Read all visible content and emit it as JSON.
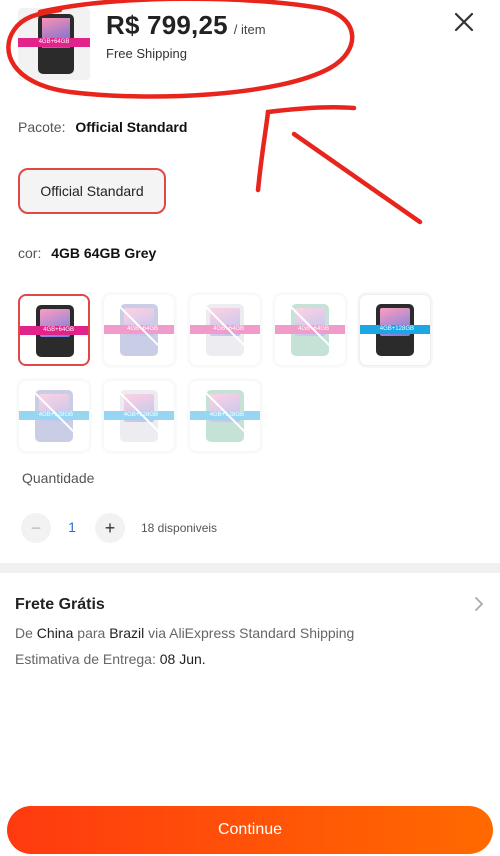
{
  "header": {
    "price": "R$ 799,25",
    "per_item": "/ item",
    "shipping_note": "Free Shipping",
    "thumb_badge": "4GB+64GB"
  },
  "package": {
    "label": "Pacote:",
    "selected": "Official Standard",
    "option": "Official Standard"
  },
  "color": {
    "label": "cor:",
    "selected": "4GB 64GB Grey"
  },
  "variants": [
    {
      "badge": "4GB+64GB",
      "phone_color": "#2b2b2b",
      "band_color": "#e0248a",
      "state": "selected"
    },
    {
      "badge": "4GB+64GB",
      "phone_color": "#8a92c8",
      "band_color": "#e0248a",
      "state": "disabled"
    },
    {
      "badge": "4GB+64GB",
      "phone_color": "#d8d8e2",
      "band_color": "#e0248a",
      "state": "disabled"
    },
    {
      "badge": "4GB+64GB",
      "phone_color": "#7fc0a8",
      "band_color": "#e0248a",
      "state": "disabled"
    },
    {
      "badge": "4GB+128GB",
      "phone_color": "#2b2b2b",
      "band_color": "#1ba6e6",
      "state": "available"
    },
    {
      "badge": "4GB+128GB",
      "phone_color": "#8a92c8",
      "band_color": "#1ba6e6",
      "state": "disabled"
    },
    {
      "badge": "4GB+128GB",
      "phone_color": "#d8d8e2",
      "band_color": "#1ba6e6",
      "state": "disabled"
    },
    {
      "badge": "4GB+128GB",
      "phone_color": "#7fc0a8",
      "band_color": "#1ba6e6",
      "state": "disabled"
    }
  ],
  "quantity": {
    "label": "Quantidade",
    "value": "1",
    "minus": "−",
    "plus": "+",
    "stock": "18 disponiveis"
  },
  "shipping": {
    "title": "Frete Grátis",
    "from_prefix": "De",
    "origin": "China",
    "to_prefix": "para",
    "destination": "Brazil",
    "via_text": "via AliExpress Standard Shipping",
    "eta_label": "Estimativa de Entrega:",
    "eta_date": "08 Jun."
  },
  "footer": {
    "continue_label": "Continue"
  },
  "colors": {
    "accent": "#ff4a0a",
    "selected_border": "#e04848",
    "annotation_red": "#e8251c"
  },
  "icons": {
    "close": "close-icon",
    "chevron": "chevron-right-icon"
  }
}
